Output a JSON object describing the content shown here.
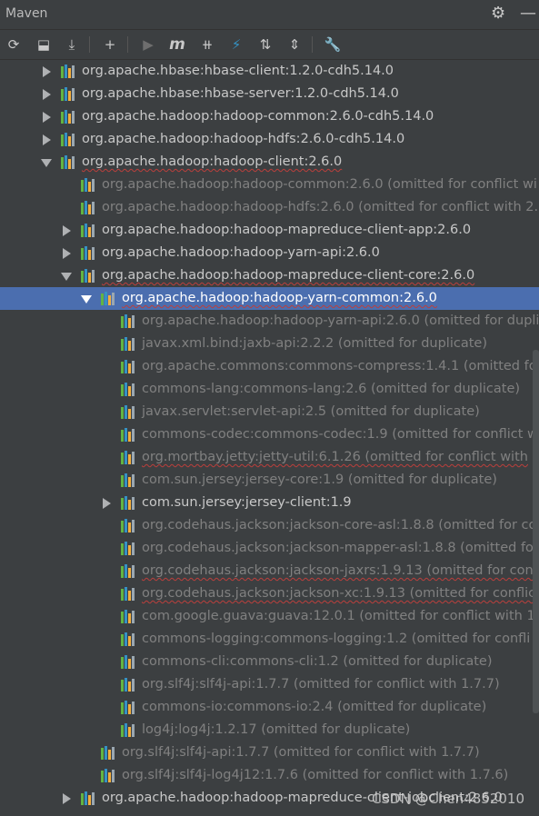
{
  "window": {
    "title": "Maven",
    "settings_icon": "gear-icon",
    "minimize_icon": "minimize-icon"
  },
  "toolbar": {
    "buttons": [
      {
        "name": "reload-icon",
        "glyph": "⟳",
        "enabled": true
      },
      {
        "name": "generate-sources-icon",
        "glyph": "⬓",
        "enabled": true
      },
      {
        "name": "download-icon",
        "glyph": "⤓",
        "enabled": true
      },
      {
        "name": "add-icon",
        "glyph": "+",
        "enabled": true
      },
      {
        "name": "run-icon",
        "glyph": "▶",
        "enabled": false
      },
      {
        "name": "execute-goal-icon",
        "glyph": "m",
        "enabled": true
      },
      {
        "name": "toggle-offline-icon",
        "glyph": "⧺",
        "enabled": true
      },
      {
        "name": "skip-tests-icon",
        "glyph": "⚡",
        "enabled": true
      },
      {
        "name": "show-dependencies-icon",
        "glyph": "⇅",
        "enabled": true
      },
      {
        "name": "collapse-all-icon",
        "glyph": "⇕",
        "enabled": true
      },
      {
        "name": "settings-wrench-icon",
        "glyph": "🔧",
        "enabled": true
      }
    ]
  },
  "tree": {
    "rows": [
      {
        "level": 0,
        "state": "collapsed",
        "text": "org.apache.hbase:hbase-client:1.2.0-cdh5.14.0",
        "omitted": false,
        "squiggle": false
      },
      {
        "level": 0,
        "state": "collapsed",
        "text": "org.apache.hbase:hbase-server:1.2.0-cdh5.14.0",
        "omitted": false,
        "squiggle": false
      },
      {
        "level": 0,
        "state": "collapsed",
        "text": "org.apache.hadoop:hadoop-common:2.6.0-cdh5.14.0",
        "omitted": false,
        "squiggle": false
      },
      {
        "level": 0,
        "state": "collapsed",
        "text": "org.apache.hadoop:hadoop-hdfs:2.6.0-cdh5.14.0",
        "omitted": false,
        "squiggle": false
      },
      {
        "level": 0,
        "state": "expanded",
        "text": "org.apache.hadoop:hadoop-client:2.6.0",
        "omitted": false,
        "squiggle": true
      },
      {
        "level": 1,
        "state": "leaf",
        "text": "org.apache.hadoop:hadoop-common:2.6.0 (omitted for conflict wi",
        "omitted": true,
        "squiggle": false
      },
      {
        "level": 1,
        "state": "leaf",
        "text": "org.apache.hadoop:hadoop-hdfs:2.6.0 (omitted for conflict with 2.",
        "omitted": true,
        "squiggle": false
      },
      {
        "level": 1,
        "state": "collapsed",
        "text": "org.apache.hadoop:hadoop-mapreduce-client-app:2.6.0",
        "omitted": false,
        "squiggle": false
      },
      {
        "level": 1,
        "state": "collapsed",
        "text": "org.apache.hadoop:hadoop-yarn-api:2.6.0",
        "omitted": false,
        "squiggle": false
      },
      {
        "level": 1,
        "state": "expanded",
        "text": "org.apache.hadoop:hadoop-mapreduce-client-core:2.6.0",
        "omitted": false,
        "squiggle": true
      },
      {
        "level": 2,
        "state": "expanded",
        "text": "org.apache.hadoop:hadoop-yarn-common:2.6.0",
        "omitted": false,
        "squiggle": true,
        "selected": true
      },
      {
        "level": 3,
        "state": "leaf",
        "text": "org.apache.hadoop:hadoop-yarn-api:2.6.0 (omitted for dupli",
        "omitted": true,
        "squiggle": false
      },
      {
        "level": 3,
        "state": "leaf",
        "text": "javax.xml.bind:jaxb-api:2.2.2 (omitted for duplicate)",
        "omitted": true,
        "squiggle": false
      },
      {
        "level": 3,
        "state": "leaf",
        "text": "org.apache.commons:commons-compress:1.4.1 (omitted fo",
        "omitted": true,
        "squiggle": false
      },
      {
        "level": 3,
        "state": "leaf",
        "text": "commons-lang:commons-lang:2.6 (omitted for duplicate)",
        "omitted": true,
        "squiggle": false
      },
      {
        "level": 3,
        "state": "leaf",
        "text": "javax.servlet:servlet-api:2.5 (omitted for duplicate)",
        "omitted": true,
        "squiggle": false
      },
      {
        "level": 3,
        "state": "leaf",
        "text": "commons-codec:commons-codec:1.9 (omitted for conflict wi",
        "omitted": true,
        "squiggle": false
      },
      {
        "level": 3,
        "state": "leaf",
        "text": "org.mortbay.jetty:jetty-util:6.1.26 (omitted for conflict with",
        "omitted": true,
        "squiggle": true
      },
      {
        "level": 3,
        "state": "leaf",
        "text": "com.sun.jersey:jersey-core:1.9 (omitted for duplicate)",
        "omitted": true,
        "squiggle": false
      },
      {
        "level": 3,
        "state": "collapsed",
        "text": "com.sun.jersey:jersey-client:1.9",
        "omitted": false,
        "squiggle": false
      },
      {
        "level": 3,
        "state": "leaf",
        "text": "org.codehaus.jackson:jackson-core-asl:1.8.8 (omitted for co",
        "omitted": true,
        "squiggle": false
      },
      {
        "level": 3,
        "state": "leaf",
        "text": "org.codehaus.jackson:jackson-mapper-asl:1.8.8 (omitted for",
        "omitted": true,
        "squiggle": false
      },
      {
        "level": 3,
        "state": "leaf",
        "text": "org.codehaus.jackson:jackson-jaxrs:1.9.13 (omitted for confl",
        "omitted": true,
        "squiggle": true
      },
      {
        "level": 3,
        "state": "leaf",
        "text": "org.codehaus.jackson:jackson-xc:1.9.13 (omitted for conflict",
        "omitted": true,
        "squiggle": true
      },
      {
        "level": 3,
        "state": "leaf",
        "text": "com.google.guava:guava:12.0.1 (omitted for conflict with 12",
        "omitted": true,
        "squiggle": false
      },
      {
        "level": 3,
        "state": "leaf",
        "text": "commons-logging:commons-logging:1.2 (omitted for confli",
        "omitted": true,
        "squiggle": false
      },
      {
        "level": 3,
        "state": "leaf",
        "text": "commons-cli:commons-cli:1.2 (omitted for duplicate)",
        "omitted": true,
        "squiggle": false
      },
      {
        "level": 3,
        "state": "leaf",
        "text": "org.slf4j:slf4j-api:1.7.7 (omitted for conflict with 1.7.7)",
        "omitted": true,
        "squiggle": false
      },
      {
        "level": 3,
        "state": "leaf",
        "text": "commons-io:commons-io:2.4 (omitted for duplicate)",
        "omitted": true,
        "squiggle": false
      },
      {
        "level": 3,
        "state": "leaf",
        "text": "log4j:log4j:1.2.17 (omitted for duplicate)",
        "omitted": true,
        "squiggle": false
      },
      {
        "level": 2,
        "state": "leaf",
        "text": "org.slf4j:slf4j-api:1.7.7 (omitted for conflict with 1.7.7)",
        "omitted": true,
        "squiggle": false
      },
      {
        "level": 2,
        "state": "leaf",
        "text": "org.slf4j:slf4j-log4j12:1.7.6 (omitted for conflict with 1.7.6)",
        "omitted": true,
        "squiggle": false
      },
      {
        "level": 1,
        "state": "collapsed",
        "text": "org.apache.hadoop:hadoop-mapreduce-client-jobclient:2.6.0",
        "omitted": false,
        "squiggle": false
      }
    ]
  },
  "watermark": "CSDN @Chen4852010",
  "colors": {
    "background": "#3c3f41",
    "selection": "#4b6eaf",
    "omitted_text": "#808080",
    "normal_text": "#c8c8c8",
    "squiggle": "#bc3f3c"
  }
}
